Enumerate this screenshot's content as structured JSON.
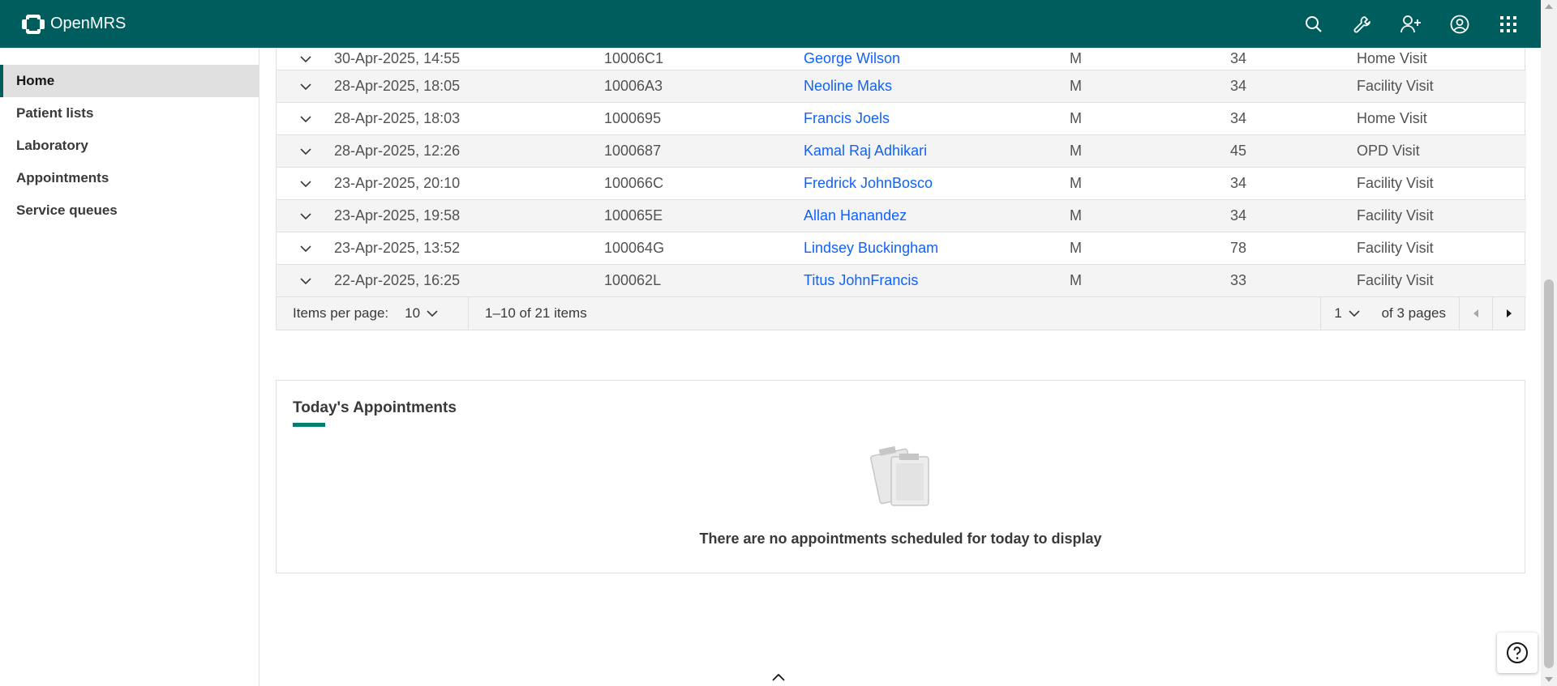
{
  "header": {
    "brand": "OpenMRS",
    "brand_color": "#005d5d",
    "icons": [
      "search-icon",
      "wrench-icon",
      "add-patient-icon",
      "user-avatar-icon",
      "app-menu-icon"
    ]
  },
  "sidebar": {
    "items": [
      {
        "label": "Home",
        "active": true
      },
      {
        "label": "Patient lists"
      },
      {
        "label": "Laboratory"
      },
      {
        "label": "Appointments"
      },
      {
        "label": "Service queues"
      }
    ]
  },
  "visits": {
    "rows": [
      {
        "date": "30-Apr-2025, 14:55",
        "id": "10006C1",
        "name": "George Wilson",
        "gender": "M",
        "age": "34",
        "visit_type": "Home Visit"
      },
      {
        "date": "28-Apr-2025, 18:05",
        "id": "10006A3",
        "name": "Neoline Maks",
        "gender": "M",
        "age": "34",
        "visit_type": "Facility Visit"
      },
      {
        "date": "28-Apr-2025, 18:03",
        "id": "1000695",
        "name": "Francis Joels",
        "gender": "M",
        "age": "34",
        "visit_type": "Home Visit"
      },
      {
        "date": "28-Apr-2025, 12:26",
        "id": "1000687",
        "name": "Kamal Raj Adhikari",
        "gender": "M",
        "age": "45",
        "visit_type": "OPD Visit"
      },
      {
        "date": "23-Apr-2025, 20:10",
        "id": "100066C",
        "name": "Fredrick JohnBosco",
        "gender": "M",
        "age": "34",
        "visit_type": "Facility Visit"
      },
      {
        "date": "23-Apr-2025, 19:58",
        "id": "100065E",
        "name": "Allan Hanandez",
        "gender": "M",
        "age": "34",
        "visit_type": "Facility Visit"
      },
      {
        "date": "23-Apr-2025, 13:52",
        "id": "100064G",
        "name": "Lindsey Buckingham",
        "gender": "M",
        "age": "78",
        "visit_type": "Facility Visit"
      },
      {
        "date": "22-Apr-2025, 16:25",
        "id": "100062L",
        "name": "Titus JohnFrancis",
        "gender": "M",
        "age": "33",
        "visit_type": "Facility Visit"
      }
    ],
    "pagination": {
      "items_per_page_label": "Items per page:",
      "items_per_page": "10",
      "range_text": "1–10 of 21 items",
      "current_page": "1",
      "of_pages_text": "of 3 pages"
    }
  },
  "appointments": {
    "title": "Today's Appointments",
    "empty_text": "There are no appointments scheduled for today to display"
  }
}
